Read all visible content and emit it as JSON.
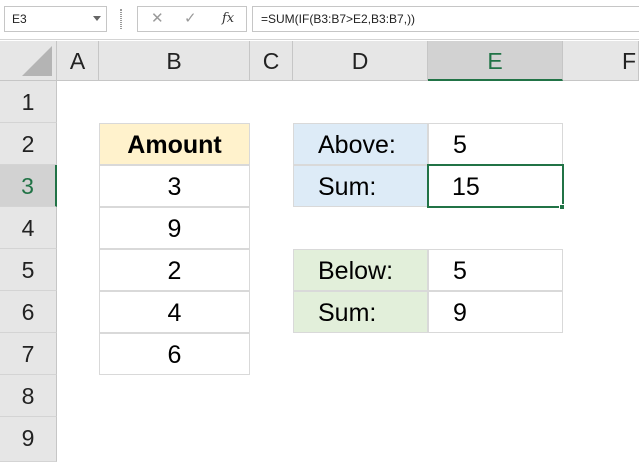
{
  "formula_bar": {
    "name_box": "E3",
    "cancel_glyph": "✕",
    "enter_glyph": "✓",
    "fx_label": "fx",
    "formula": "=SUM(IF(B3:B7>E2,B3:B7,))"
  },
  "columns": [
    "A",
    "B",
    "C",
    "D",
    "E",
    "F"
  ],
  "rows": [
    "1",
    "2",
    "3",
    "4",
    "5",
    "6",
    "7",
    "8",
    "9"
  ],
  "selected_cell": "E3",
  "table": {
    "header": "Amount",
    "values": [
      "3",
      "9",
      "2",
      "4",
      "6"
    ]
  },
  "above": {
    "label": "Above:",
    "value": "5",
    "sum_label": "Sum:",
    "sum_value": "15"
  },
  "below": {
    "label": "Below:",
    "value": "5",
    "sum_label": "Sum:",
    "sum_value": "9"
  },
  "colors": {
    "accent": "#217346",
    "header_fill": "#fff2cc",
    "above_fill": "#ddebf7",
    "below_fill": "#e2efda"
  }
}
